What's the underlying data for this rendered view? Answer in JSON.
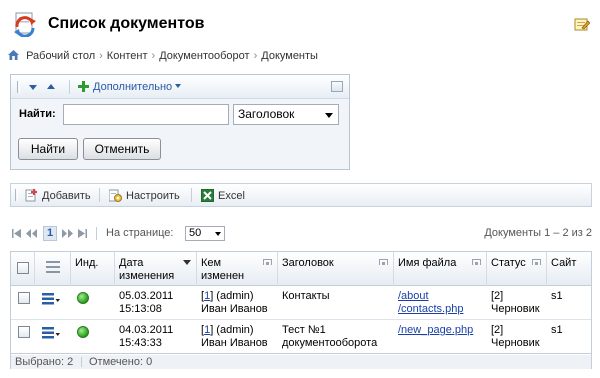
{
  "page": {
    "title": "Список документов"
  },
  "breadcrumb": [
    "Рабочий стол",
    "Контент",
    "Документооборот",
    "Документы"
  ],
  "filter": {
    "more_label": "Дополнительно",
    "find_label": "Найти:",
    "find_value": "",
    "field_select": "Заголовок",
    "find_button": "Найти",
    "cancel_button": "Отменить"
  },
  "toolbar": {
    "add_label": "Добавить",
    "settings_label": "Настроить",
    "excel_label": "Excel"
  },
  "pager": {
    "current_page": "1",
    "per_page_label": "На странице:",
    "per_page_value": "50",
    "count_text": "Документы 1 – 2 из 2"
  },
  "grid": {
    "columns": [
      "Инд.",
      "Дата изменения",
      "Кем изменен",
      "Заголовок",
      "Имя файла",
      "Статус",
      "Сайт"
    ],
    "column_lines": [
      [
        "Инд."
      ],
      [
        "Дата",
        "изменения"
      ],
      [
        "Кем",
        "изменен"
      ],
      [
        "Заголовок"
      ],
      [
        "Имя файла"
      ],
      [
        "Статус"
      ],
      [
        "Сайт"
      ]
    ],
    "rows": [
      {
        "date": [
          "05.03.2011",
          "15:13:08"
        ],
        "modified_by": [
          "[1] (admin)",
          "Иван Иванов"
        ],
        "modified_by_id": "1",
        "title": [
          "Контакты",
          ""
        ],
        "file": [
          "/about",
          "/contacts.php"
        ],
        "status": [
          "[2]",
          "Черновик"
        ],
        "site": "s1"
      },
      {
        "date": [
          "04.03.2011",
          "15:43:33"
        ],
        "modified_by": [
          "[1] (admin)",
          "Иван Иванов"
        ],
        "modified_by_id": "1",
        "title": [
          "Тест №1",
          "документооборота"
        ],
        "file": [
          "/new_page.php",
          ""
        ],
        "status": [
          "[2]",
          "Черновик"
        ],
        "site": "s1"
      }
    ],
    "footer": {
      "selected": "Выбрано: 2",
      "checked": "Отмечено: 0"
    }
  },
  "colors": {
    "link": "#1a3fa8",
    "accent_blue": "#2b5aa6",
    "status_indicator": "#2a9d1d"
  }
}
